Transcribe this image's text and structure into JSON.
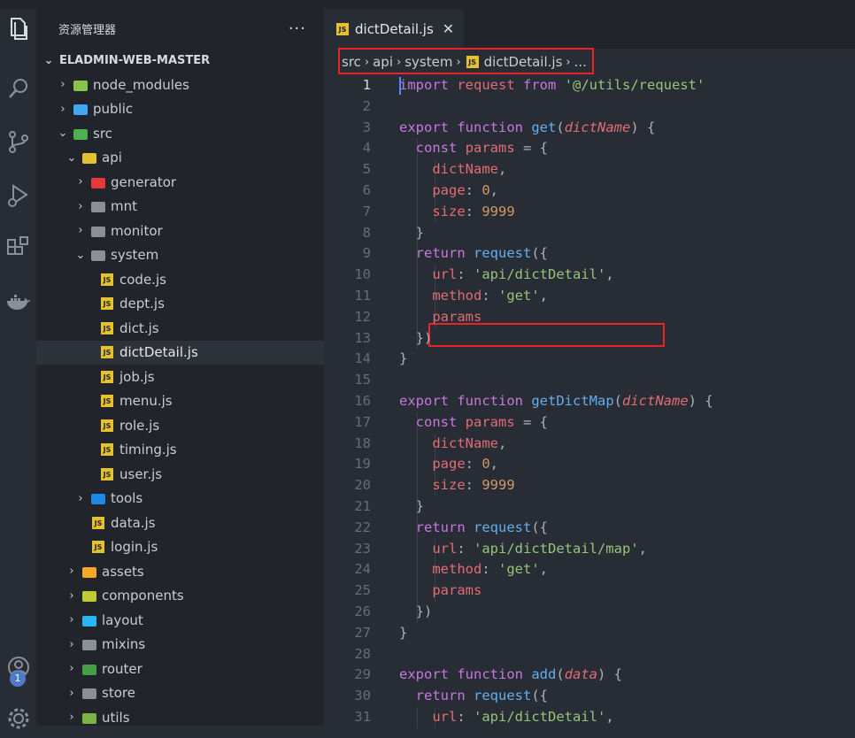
{
  "sidebar": {
    "title": "资源管理器",
    "more": "···",
    "root": "ELADMIN-WEB-MASTER",
    "items": [
      {
        "label": "node_modules",
        "depth": 0,
        "chev": "›",
        "icon": "folder-green",
        "color": "#8bc34a"
      },
      {
        "label": "public",
        "depth": 0,
        "chev": "›",
        "icon": "folder-blue",
        "color": "#42a5f5"
      },
      {
        "label": "src",
        "depth": 0,
        "chev": "⌄",
        "icon": "folder-src",
        "color": "#4caf50"
      },
      {
        "label": "api",
        "depth": 1,
        "chev": "⌄",
        "icon": "folder-api",
        "color": "#e5c12e"
      },
      {
        "label": "generator",
        "depth": 2,
        "chev": "›",
        "icon": "folder-red",
        "color": "#e53935"
      },
      {
        "label": "mnt",
        "depth": 2,
        "chev": "›",
        "icon": "folder",
        "color": "#8a8f98"
      },
      {
        "label": "monitor",
        "depth": 2,
        "chev": "›",
        "icon": "folder",
        "color": "#8a8f98"
      },
      {
        "label": "system",
        "depth": 2,
        "chev": "⌄",
        "icon": "folder-open",
        "color": "#8a8f98"
      },
      {
        "label": "code.js",
        "depth": 3,
        "chev": "",
        "icon": "js",
        "color": "#e5c12e"
      },
      {
        "label": "dept.js",
        "depth": 3,
        "chev": "",
        "icon": "js",
        "color": "#e5c12e"
      },
      {
        "label": "dict.js",
        "depth": 3,
        "chev": "",
        "icon": "js",
        "color": "#e5c12e"
      },
      {
        "label": "dictDetail.js",
        "depth": 3,
        "chev": "",
        "icon": "js",
        "color": "#e5c12e",
        "selected": true
      },
      {
        "label": "job.js",
        "depth": 3,
        "chev": "",
        "icon": "js",
        "color": "#e5c12e"
      },
      {
        "label": "menu.js",
        "depth": 3,
        "chev": "",
        "icon": "js",
        "color": "#e5c12e"
      },
      {
        "label": "role.js",
        "depth": 3,
        "chev": "",
        "icon": "js",
        "color": "#e5c12e"
      },
      {
        "label": "timing.js",
        "depth": 3,
        "chev": "",
        "icon": "js",
        "color": "#e5c12e"
      },
      {
        "label": "user.js",
        "depth": 3,
        "chev": "",
        "icon": "js",
        "color": "#e5c12e"
      },
      {
        "label": "tools",
        "depth": 2,
        "chev": "›",
        "icon": "folder-blue",
        "color": "#1e88e5"
      },
      {
        "label": "data.js",
        "depth": 2,
        "chev": "",
        "icon": "js",
        "color": "#e5c12e"
      },
      {
        "label": "login.js",
        "depth": 2,
        "chev": "",
        "icon": "js",
        "color": "#e5c12e"
      },
      {
        "label": "assets",
        "depth": 1,
        "chev": "›",
        "icon": "folder",
        "color": "#f9a825"
      },
      {
        "label": "components",
        "depth": 1,
        "chev": "›",
        "icon": "folder",
        "color": "#c0ca33"
      },
      {
        "label": "layout",
        "depth": 1,
        "chev": "›",
        "icon": "folder",
        "color": "#29b6f6"
      },
      {
        "label": "mixins",
        "depth": 1,
        "chev": "›",
        "icon": "folder",
        "color": "#8a8f98"
      },
      {
        "label": "router",
        "depth": 1,
        "chev": "›",
        "icon": "folder",
        "color": "#43a047"
      },
      {
        "label": "store",
        "depth": 1,
        "chev": "›",
        "icon": "folder",
        "color": "#8a8f98"
      },
      {
        "label": "utils",
        "depth": 1,
        "chev": "›",
        "icon": "folder",
        "color": "#7cb342"
      }
    ]
  },
  "activity": {
    "icons": [
      "files-icon",
      "search-icon",
      "source-control-icon",
      "run-debug-icon",
      "extensions-icon",
      "docker-icon",
      "account-icon",
      "settings-icon"
    ],
    "badge": "1"
  },
  "editor": {
    "tab": {
      "label": "dictDetail.js",
      "close": "✕"
    },
    "breadcrumbs": [
      "src",
      "api",
      "system",
      "dictDetail.js",
      "..."
    ],
    "current_line": 1,
    "lines": [
      {
        "n": "1",
        "t": [
          [
            "kw",
            "import"
          ],
          [
            "pun",
            " "
          ],
          [
            "plain",
            "request"
          ],
          [
            "pun",
            " "
          ],
          [
            "kw",
            "from"
          ],
          [
            "pun",
            " "
          ],
          [
            "str",
            "'@/utils/request'"
          ]
        ]
      },
      {
        "n": "2",
        "t": []
      },
      {
        "n": "3",
        "t": [
          [
            "kw",
            "export"
          ],
          [
            "pun",
            " "
          ],
          [
            "kw",
            "function"
          ],
          [
            "pun",
            " "
          ],
          [
            "fn",
            "get"
          ],
          [
            "pun",
            "("
          ],
          [
            "param",
            "dictName"
          ],
          [
            "pun",
            ") {"
          ]
        ]
      },
      {
        "n": "4",
        "t": [
          [
            "pun",
            "  "
          ],
          [
            "kw",
            "const"
          ],
          [
            "pun",
            " "
          ],
          [
            "plain",
            "params"
          ],
          [
            "pun",
            " = {"
          ]
        ]
      },
      {
        "n": "5",
        "t": [
          [
            "pun",
            "    "
          ],
          [
            "prop",
            "dictName"
          ],
          [
            "pun",
            ","
          ]
        ]
      },
      {
        "n": "6",
        "t": [
          [
            "pun",
            "    "
          ],
          [
            "prop",
            "page"
          ],
          [
            "pun",
            ": "
          ],
          [
            "num",
            "0"
          ],
          [
            "pun",
            ","
          ]
        ]
      },
      {
        "n": "7",
        "t": [
          [
            "pun",
            "    "
          ],
          [
            "prop",
            "size"
          ],
          [
            "pun",
            ": "
          ],
          [
            "num",
            "9999"
          ]
        ]
      },
      {
        "n": "8",
        "t": [
          [
            "pun",
            "  }"
          ]
        ]
      },
      {
        "n": "9",
        "t": [
          [
            "pun",
            "  "
          ],
          [
            "kw",
            "return"
          ],
          [
            "pun",
            " "
          ],
          [
            "fn",
            "request"
          ],
          [
            "pun",
            "({"
          ]
        ]
      },
      {
        "n": "10",
        "t": [
          [
            "pun",
            "    "
          ],
          [
            "prop",
            "url"
          ],
          [
            "pun",
            ": "
          ],
          [
            "str",
            "'api/dictDetail'"
          ],
          [
            "pun",
            ","
          ]
        ]
      },
      {
        "n": "11",
        "t": [
          [
            "pun",
            "    "
          ],
          [
            "prop",
            "method"
          ],
          [
            "pun",
            ": "
          ],
          [
            "str",
            "'get'"
          ],
          [
            "pun",
            ","
          ]
        ]
      },
      {
        "n": "12",
        "t": [
          [
            "pun",
            "    "
          ],
          [
            "prop",
            "params"
          ]
        ]
      },
      {
        "n": "13",
        "t": [
          [
            "pun",
            "  })"
          ]
        ]
      },
      {
        "n": "14",
        "t": [
          [
            "pun",
            "}"
          ]
        ]
      },
      {
        "n": "15",
        "t": []
      },
      {
        "n": "16",
        "t": [
          [
            "kw",
            "export"
          ],
          [
            "pun",
            " "
          ],
          [
            "kw",
            "function"
          ],
          [
            "pun",
            " "
          ],
          [
            "fn",
            "getDictMap"
          ],
          [
            "pun",
            "("
          ],
          [
            "param",
            "dictName"
          ],
          [
            "pun",
            ") {"
          ]
        ]
      },
      {
        "n": "17",
        "t": [
          [
            "pun",
            "  "
          ],
          [
            "kw",
            "const"
          ],
          [
            "pun",
            " "
          ],
          [
            "plain",
            "params"
          ],
          [
            "pun",
            " = {"
          ]
        ]
      },
      {
        "n": "18",
        "t": [
          [
            "pun",
            "    "
          ],
          [
            "prop",
            "dictName"
          ],
          [
            "pun",
            ","
          ]
        ]
      },
      {
        "n": "19",
        "t": [
          [
            "pun",
            "    "
          ],
          [
            "prop",
            "page"
          ],
          [
            "pun",
            ": "
          ],
          [
            "num",
            "0"
          ],
          [
            "pun",
            ","
          ]
        ]
      },
      {
        "n": "20",
        "t": [
          [
            "pun",
            "    "
          ],
          [
            "prop",
            "size"
          ],
          [
            "pun",
            ": "
          ],
          [
            "num",
            "9999"
          ]
        ]
      },
      {
        "n": "21",
        "t": [
          [
            "pun",
            "  }"
          ]
        ]
      },
      {
        "n": "22",
        "t": [
          [
            "pun",
            "  "
          ],
          [
            "kw",
            "return"
          ],
          [
            "pun",
            " "
          ],
          [
            "fn",
            "request"
          ],
          [
            "pun",
            "({"
          ]
        ]
      },
      {
        "n": "23",
        "t": [
          [
            "pun",
            "    "
          ],
          [
            "prop",
            "url"
          ],
          [
            "pun",
            ": "
          ],
          [
            "str",
            "'api/dictDetail/map'"
          ],
          [
            "pun",
            ","
          ]
        ]
      },
      {
        "n": "24",
        "t": [
          [
            "pun",
            "    "
          ],
          [
            "prop",
            "method"
          ],
          [
            "pun",
            ": "
          ],
          [
            "str",
            "'get'"
          ],
          [
            "pun",
            ","
          ]
        ]
      },
      {
        "n": "25",
        "t": [
          [
            "pun",
            "    "
          ],
          [
            "prop",
            "params"
          ]
        ]
      },
      {
        "n": "26",
        "t": [
          [
            "pun",
            "  })"
          ]
        ]
      },
      {
        "n": "27",
        "t": [
          [
            "pun",
            "}"
          ]
        ]
      },
      {
        "n": "28",
        "t": []
      },
      {
        "n": "29",
        "t": [
          [
            "kw",
            "export"
          ],
          [
            "pun",
            " "
          ],
          [
            "kw",
            "function"
          ],
          [
            "pun",
            " "
          ],
          [
            "fn",
            "add"
          ],
          [
            "pun",
            "("
          ],
          [
            "param",
            "data"
          ],
          [
            "pun",
            ") {"
          ]
        ]
      },
      {
        "n": "30",
        "t": [
          [
            "pun",
            "  "
          ],
          [
            "kw",
            "return"
          ],
          [
            "pun",
            " "
          ],
          [
            "fn",
            "request"
          ],
          [
            "pun",
            "({"
          ]
        ]
      },
      {
        "n": "31",
        "t": [
          [
            "pun",
            "    "
          ],
          [
            "prop",
            "url"
          ],
          [
            "pun",
            ": "
          ],
          [
            "str",
            "'api/dictDetail'"
          ],
          [
            "pun",
            ","
          ]
        ]
      }
    ]
  },
  "colors": {
    "highlight_box": "#e8242b",
    "accent": "#528bff"
  }
}
